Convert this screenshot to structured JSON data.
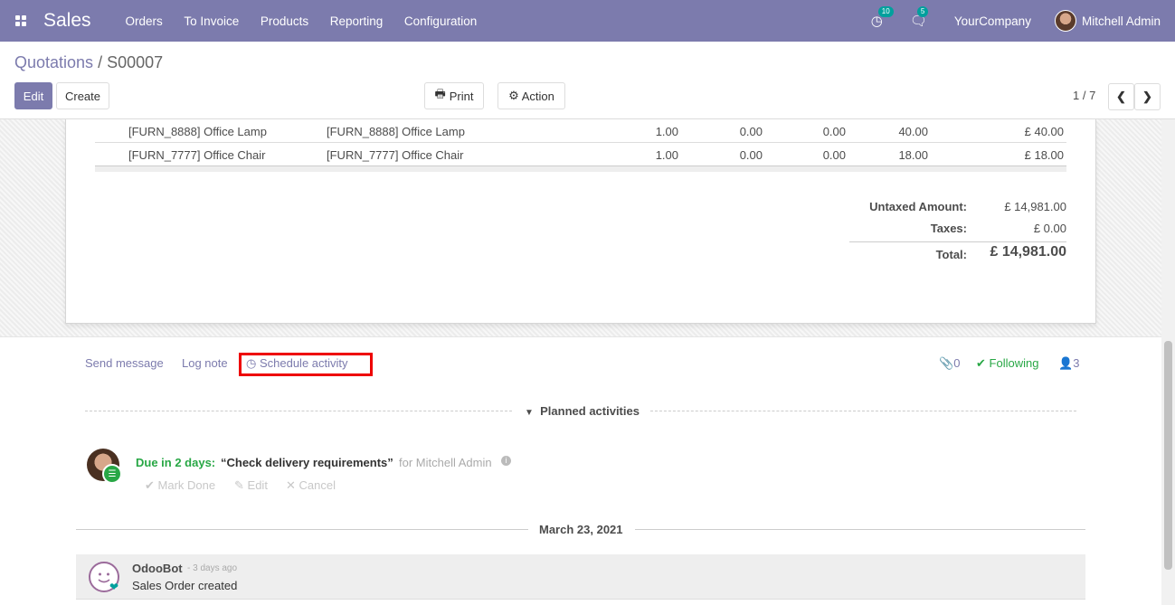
{
  "navbar": {
    "app_name": "Sales",
    "menu": [
      "Orders",
      "To Invoice",
      "Products",
      "Reporting",
      "Configuration"
    ],
    "activity_count": "10",
    "message_count": "5",
    "company": "YourCompany",
    "user": "Mitchell Admin",
    "bg_color": "#7c7bad"
  },
  "breadcrumb": {
    "parent": "Quotations",
    "separator": " / ",
    "current": "S00007"
  },
  "buttons": {
    "edit": "Edit",
    "create": "Create",
    "print": "Print",
    "action": "Action"
  },
  "pager": {
    "value": "1 / 7"
  },
  "order_lines": [
    {
      "product": "[FURN_8888] Office Lamp",
      "description": "[FURN_8888] Office Lamp",
      "qty": "1.00",
      "col4": "0.00",
      "col5": "0.00",
      "unit_price": "40.00",
      "subtotal": "£ 40.00"
    },
    {
      "product": "[FURN_7777] Office Chair",
      "description": "[FURN_7777] Office Chair",
      "qty": "1.00",
      "col4": "0.00",
      "col5": "0.00",
      "unit_price": "18.00",
      "subtotal": "£ 18.00"
    }
  ],
  "totals": {
    "untaxed_label": "Untaxed Amount:",
    "untaxed_value": "£ 14,981.00",
    "taxes_label": "Taxes:",
    "taxes_value": "£ 0.00",
    "total_label": "Total:",
    "total_value": "£ 14,981.00"
  },
  "chatter": {
    "send_message": "Send message",
    "log_note": "Log note",
    "schedule_activity": "Schedule activity",
    "attachments": "0",
    "following": "Following",
    "followers": "3",
    "planned_header": "Planned activities",
    "activity": {
      "due": "Due in 2 days:",
      "summary": "“Check delivery requirements”",
      "for": "for Mitchell Admin",
      "mark_done": "Mark Done",
      "edit": "Edit",
      "cancel": "Cancel"
    },
    "date_separator": "March 23, 2021",
    "message": {
      "author": "OdooBot",
      "ago": "- 3 days ago",
      "body": "Sales Order created"
    }
  }
}
